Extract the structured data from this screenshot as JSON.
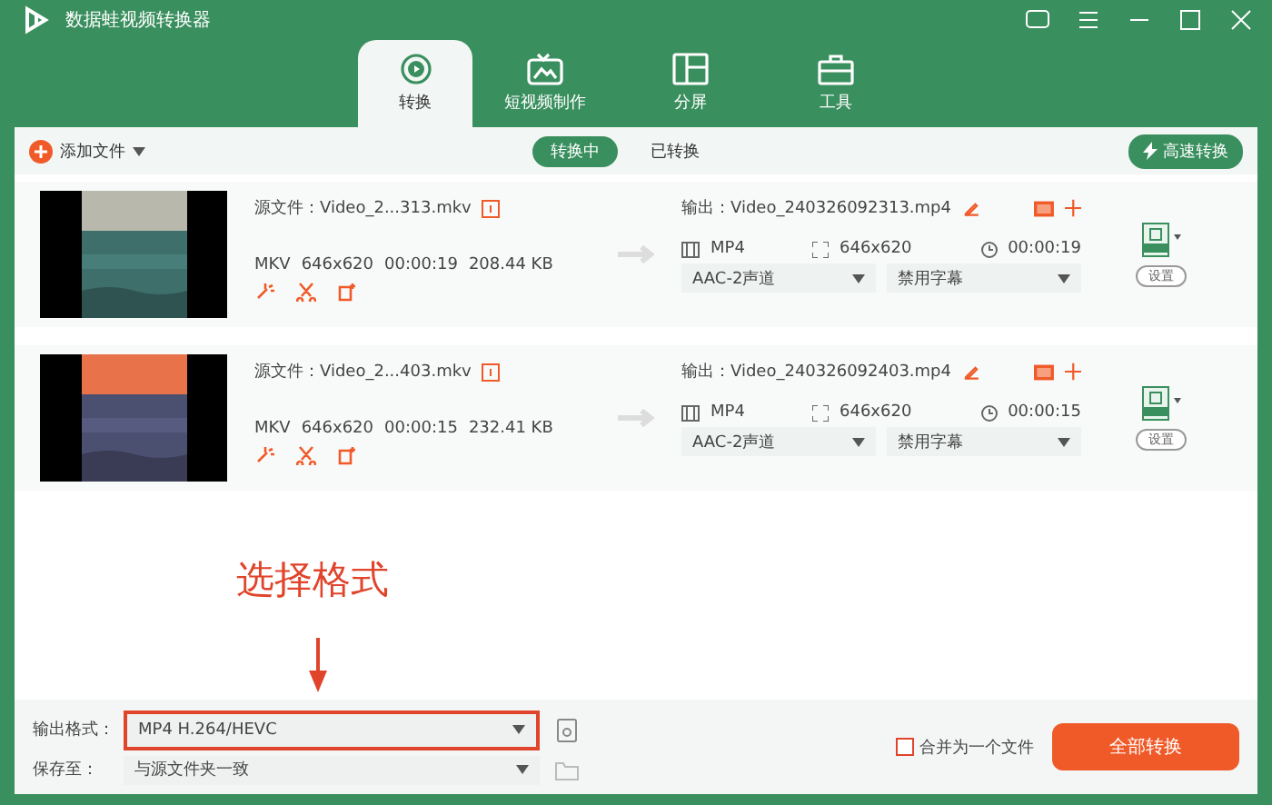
{
  "app_title": "数据蛙视频转换器",
  "tabs": [
    {
      "label": "转换",
      "selected": true,
      "kind": "convert"
    },
    {
      "label": "短视频制作",
      "selected": false,
      "kind": "tv"
    },
    {
      "label": "分屏",
      "selected": false,
      "kind": "split"
    },
    {
      "label": "工具",
      "selected": false,
      "kind": "toolbox"
    }
  ],
  "toolbar": {
    "add_file": "添加文件",
    "filters": [
      {
        "label": "转换中",
        "selected": true
      },
      {
        "label": "已转换",
        "selected": false
      }
    ],
    "fast_convert": "高速转换"
  },
  "files": [
    {
      "kind": "picture",
      "source": "源文件：Video_2...313.mkv",
      "format": "MKV",
      "resolution": "646x620",
      "duration": "00:00:19",
      "size": "208.44 KB",
      "output": "输出：Video_240326092313.mp4",
      "out_format": "MP4",
      "out_resolution": "646x620",
      "out_duration": "00:00:19",
      "audio": "AAC-2声道",
      "subtitle": "禁用字幕",
      "settings": "设置"
    },
    {
      "kind": "picture",
      "source": "源文件：Video_2...403.mkv",
      "format": "MKV",
      "resolution": "646x620",
      "duration": "00:00:15",
      "size": "232.41 KB",
      "output": "输出：Video_240326092403.mp4",
      "out_format": "MP4",
      "out_resolution": "646x620",
      "out_duration": "00:00:15",
      "audio": "AAC-2声道",
      "subtitle": "禁用字幕",
      "settings": "设置"
    }
  ],
  "annotation": {
    "text": "选择格式"
  },
  "bottom": {
    "format_label": "输出格式：",
    "format_value": "MP4 H.264/HEVC",
    "save_label": "保存至：",
    "save_value": "与源文件夹一致",
    "merge": {
      "label": "合并为一个文件",
      "checked": false
    },
    "convert_all": "全部转换"
  }
}
